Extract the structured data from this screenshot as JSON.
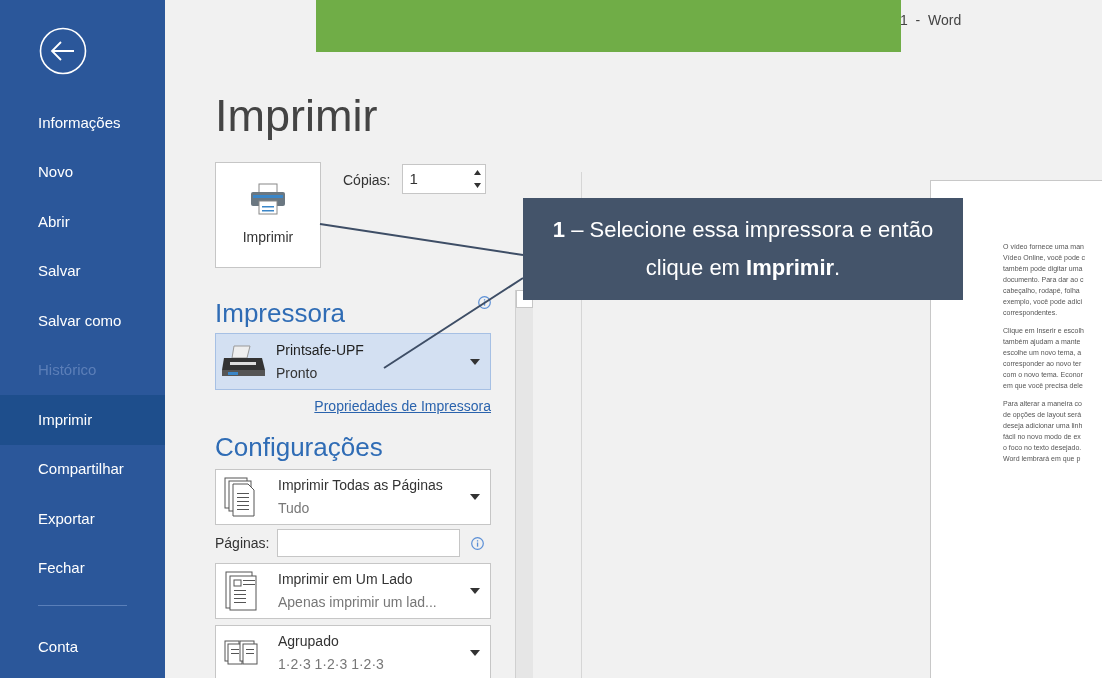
{
  "window": {
    "title": "1  -  Word"
  },
  "sidebar": {
    "items": [
      {
        "label": "Informações",
        "selected": false,
        "disabled": false
      },
      {
        "label": "Novo",
        "selected": false,
        "disabled": false
      },
      {
        "label": "Abrir",
        "selected": false,
        "disabled": false
      },
      {
        "label": "Salvar",
        "selected": false,
        "disabled": false
      },
      {
        "label": "Salvar como",
        "selected": false,
        "disabled": false
      },
      {
        "label": "Histórico",
        "selected": false,
        "disabled": true
      },
      {
        "label": "Imprimir",
        "selected": true,
        "disabled": false
      },
      {
        "label": "Compartilhar",
        "selected": false,
        "disabled": false
      },
      {
        "label": "Exportar",
        "selected": false,
        "disabled": false
      },
      {
        "label": "Fechar",
        "selected": false,
        "disabled": false
      }
    ],
    "footer_item": {
      "label": "Conta",
      "selected": false,
      "disabled": false
    }
  },
  "heading": "Imprimir",
  "print_button": {
    "label": "Imprimir"
  },
  "copies": {
    "label": "Cópias:",
    "value": "1"
  },
  "printer": {
    "heading": "Impressora",
    "name": "Printsafe-UPF",
    "status": "Pronto",
    "link": "Propriedades de Impressora"
  },
  "settings": {
    "heading": "Configurações",
    "dropdowns": [
      {
        "kind": "pages",
        "title": "Imprimir Todas as Páginas",
        "subtitle": "Tudo"
      },
      {
        "kind": "sides",
        "title": "Imprimir em Um Lado",
        "subtitle": "Apenas imprimir um lad..."
      },
      {
        "kind": "collate",
        "title": "Agrupado",
        "subtitle": "1·2·3    1·2·3    1·2·3"
      }
    ],
    "pages_field": {
      "label": "Páginas:"
    }
  },
  "callout": {
    "text": "**1** – Selecione essa impressora e então clique em **Imprimir**."
  },
  "preview": {
    "paragraphs": [
      [
        "O vídeo fornece uma man",
        "Vídeo Online, você pode c",
        "também pode digitar uma",
        "documento. Para dar ao c",
        "cabeçalho, rodapé, folha",
        "exemplo, você pode adici",
        "correspondentes."
      ],
      [
        "Clique em Inserir e escolh",
        "também ajudam a mante",
        "escolhe um novo tema, a",
        "corresponder ao novo ter",
        "com o novo tema. Econor",
        "em que você precisa dele"
      ],
      [
        "Para alterar a maneira co",
        "de opções de layout será",
        "deseja adicionar uma linh",
        "fácil no novo modo de ex",
        "o foco no texto desejado.",
        "Word lembrará em que p"
      ]
    ]
  }
}
